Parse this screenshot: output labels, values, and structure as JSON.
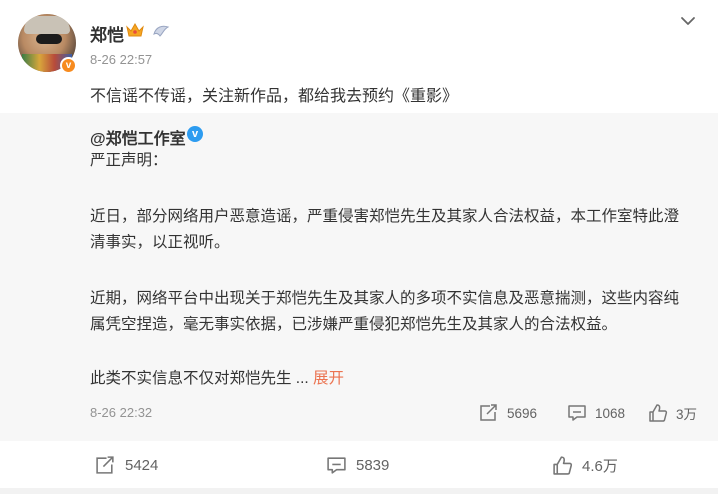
{
  "post": {
    "author": "郑恺",
    "time": "8-26 22:57",
    "text": "不信谣不传谣，关注新作品，都给我去预约《重影》",
    "verified_badge": "v",
    "icons": [
      "crown-icon",
      "vip-icon",
      "chevron-down-icon"
    ]
  },
  "quote": {
    "author": "@郑恺工作室",
    "verified_mark": "v",
    "lines": [
      "严正声明：",
      "近日，部分网络用户恶意造谣，严重侵害郑恺先生及其家人合法权益，本工作室特此澄",
      "清事实，以正视听。",
      "近期，网络平台中出现关于郑恺先生及其家人的多项不实信息及恶意揣测，这些内容纯",
      "属凭空捏造，毫无事实依据，已涉嫌严重侵犯郑恺先生及其家人的合法权益。",
      "此类不实信息不仅对郑恺先生 ..."
    ],
    "expand_label": "展开",
    "time": "8-26 22:32",
    "stats": {
      "reposts": "5696",
      "comments": "1068",
      "likes": "3万"
    }
  },
  "toolbar": {
    "reposts": "5424",
    "comments": "5839",
    "likes": "4.6万"
  }
}
